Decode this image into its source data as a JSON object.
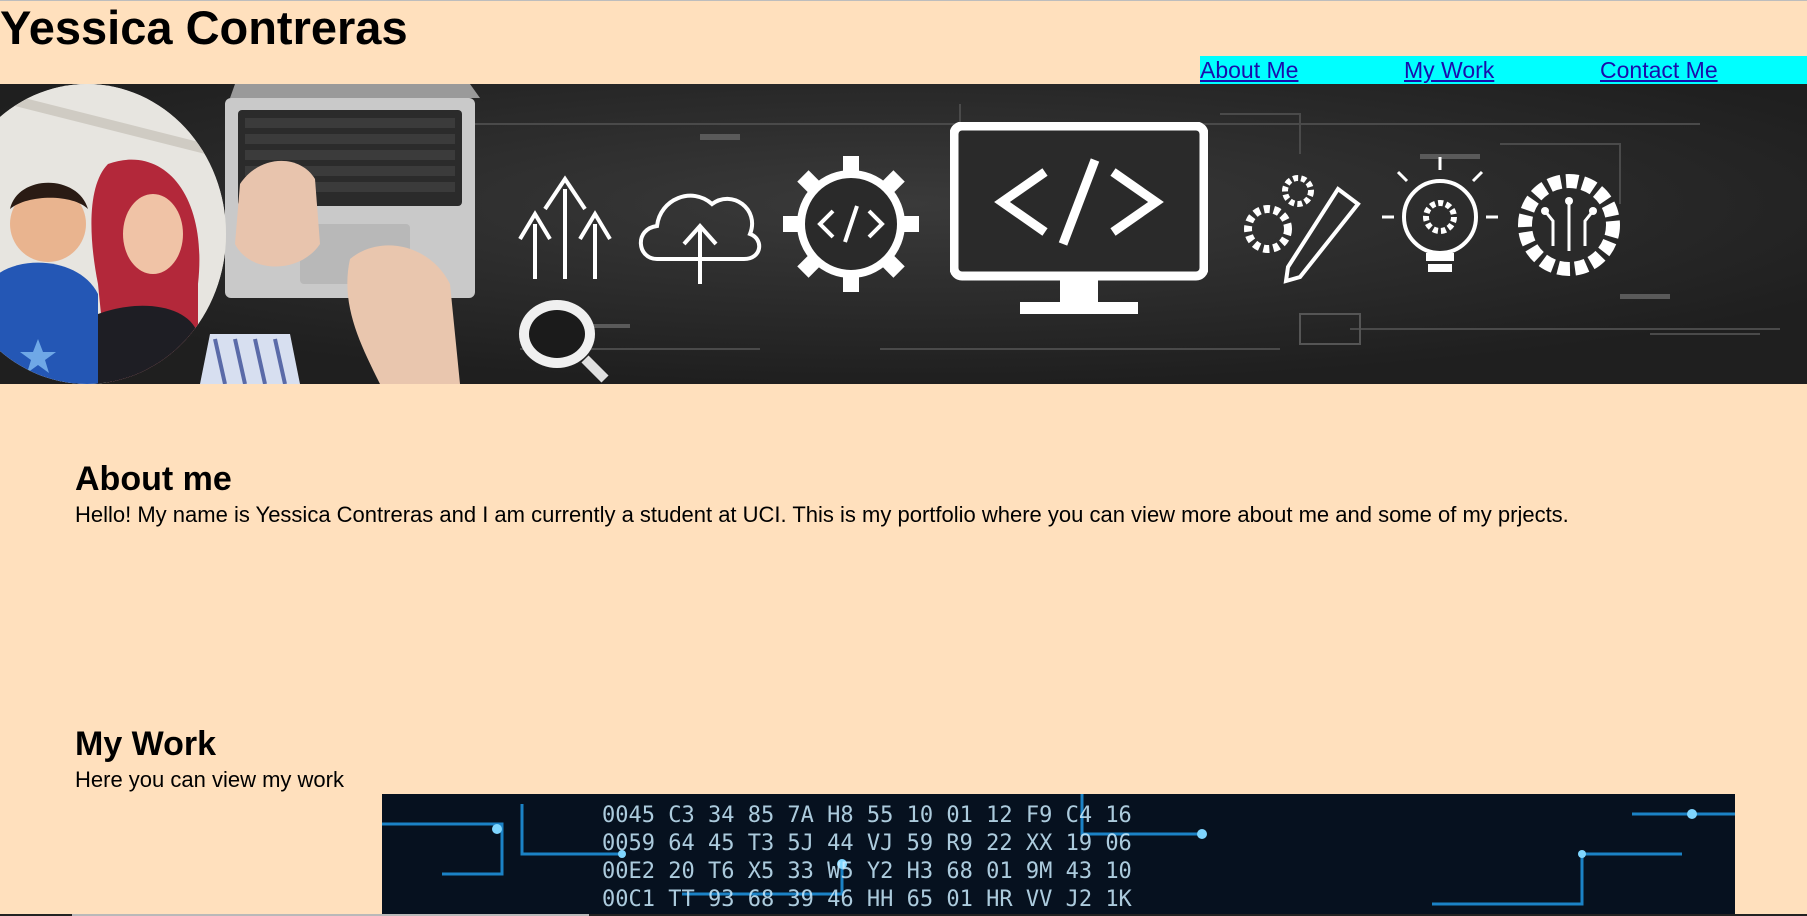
{
  "header": {
    "title": "Yessica Contreras"
  },
  "nav": {
    "items": [
      {
        "label": "About Me"
      },
      {
        "label": "My Work"
      },
      {
        "label": "Contact Me"
      }
    ]
  },
  "hero": {
    "icons": [
      "upload-arrows-icon",
      "cloud-upload-icon",
      "code-gear-icon",
      "monitor-code-icon",
      "gear-pencil-icon",
      "lightbulb-gear-icon",
      "circuit-gear-icon"
    ]
  },
  "about": {
    "title": "About me",
    "text": "Hello! My name is Yessica Contreras and I am currently a student at UCI. This is my portfolio where you can view more about me and some of my prjects."
  },
  "work": {
    "title": "My Work",
    "text": "Here you can view my work"
  },
  "colors": {
    "page_background": "#ffe0bd",
    "nav_background": "#00ffff",
    "link": "#1a0dab",
    "hero_background": "#2a2a2a"
  }
}
